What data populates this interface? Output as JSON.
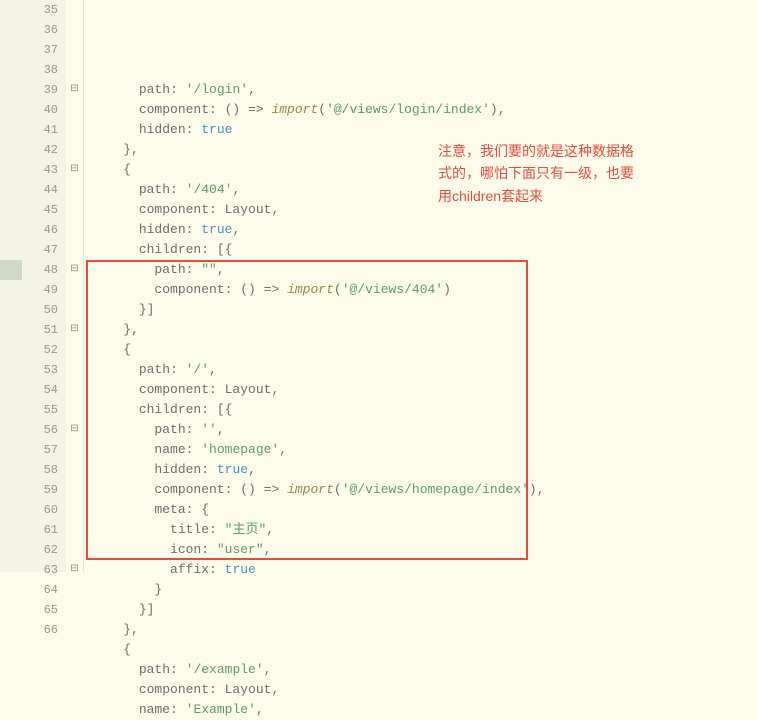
{
  "annotation": {
    "line1": "注意，我们要的就是这种数据格",
    "line2": "式的，哪怕下面只有一级，也要",
    "line3": "用children套起来"
  },
  "lines": [
    {
      "num": 35,
      "fold": false,
      "mark": false,
      "indent": 3,
      "tokens": [
        [
          "prop",
          "path"
        ],
        [
          "pun",
          ": "
        ],
        [
          "str",
          "'/login'"
        ],
        [
          "pun",
          ","
        ]
      ]
    },
    {
      "num": 36,
      "fold": false,
      "mark": false,
      "indent": 3,
      "tokens": [
        [
          "prop",
          "component"
        ],
        [
          "pun",
          ": () => "
        ],
        [
          "imp",
          "import"
        ],
        [
          "pun",
          "("
        ],
        [
          "str",
          "'@/views/login/index'"
        ],
        [
          "pun",
          "),"
        ]
      ]
    },
    {
      "num": 37,
      "fold": false,
      "mark": false,
      "indent": 3,
      "tokens": [
        [
          "prop",
          "hidden"
        ],
        [
          "pun",
          ": "
        ],
        [
          "bool",
          "true"
        ]
      ]
    },
    {
      "num": 38,
      "fold": false,
      "mark": false,
      "indent": 2,
      "tokens": [
        [
          "pun",
          "},"
        ]
      ]
    },
    {
      "num": 39,
      "fold": true,
      "mark": false,
      "indent": 2,
      "tokens": [
        [
          "pun",
          "{"
        ]
      ]
    },
    {
      "num": 40,
      "fold": false,
      "mark": false,
      "indent": 3,
      "tokens": [
        [
          "prop",
          "path"
        ],
        [
          "pun",
          ": "
        ],
        [
          "str",
          "'/404'"
        ],
        [
          "pun",
          ","
        ]
      ]
    },
    {
      "num": 41,
      "fold": false,
      "mark": false,
      "indent": 3,
      "tokens": [
        [
          "prop",
          "component"
        ],
        [
          "pun",
          ": Layout,"
        ]
      ]
    },
    {
      "num": 42,
      "fold": false,
      "mark": false,
      "indent": 3,
      "tokens": [
        [
          "prop",
          "hidden"
        ],
        [
          "pun",
          ": "
        ],
        [
          "bool",
          "true"
        ],
        [
          "pun",
          ","
        ]
      ]
    },
    {
      "num": 43,
      "fold": true,
      "mark": false,
      "indent": 3,
      "tokens": [
        [
          "prop",
          "children"
        ],
        [
          "pun",
          ": [{"
        ]
      ]
    },
    {
      "num": 44,
      "fold": false,
      "mark": false,
      "indent": 4,
      "tokens": [
        [
          "prop",
          "path"
        ],
        [
          "pun",
          ": "
        ],
        [
          "str",
          "\"\""
        ],
        [
          "pun",
          ","
        ]
      ]
    },
    {
      "num": 45,
      "fold": false,
      "mark": false,
      "indent": 4,
      "tokens": [
        [
          "prop",
          "component"
        ],
        [
          "pun",
          ": () => "
        ],
        [
          "imp",
          "import"
        ],
        [
          "pun",
          "("
        ],
        [
          "str",
          "'@/views/404'"
        ],
        [
          "pun",
          ")"
        ]
      ]
    },
    {
      "num": 46,
      "fold": false,
      "mark": false,
      "indent": 3,
      "tokens": [
        [
          "pun",
          "}]"
        ]
      ]
    },
    {
      "num": 47,
      "fold": false,
      "mark": false,
      "indent": 2,
      "tokens": [
        [
          "pun",
          "},"
        ]
      ]
    },
    {
      "num": 48,
      "fold": true,
      "mark": true,
      "indent": 2,
      "tokens": [
        [
          "pun",
          "{"
        ]
      ]
    },
    {
      "num": 49,
      "fold": false,
      "mark": false,
      "indent": 3,
      "tokens": [
        [
          "prop",
          "path"
        ],
        [
          "pun",
          ": "
        ],
        [
          "str",
          "'/'"
        ],
        [
          "pun",
          ","
        ]
      ]
    },
    {
      "num": 50,
      "fold": false,
      "mark": false,
      "indent": 3,
      "tokens": [
        [
          "prop",
          "component"
        ],
        [
          "pun",
          ": Layout,"
        ]
      ]
    },
    {
      "num": 51,
      "fold": true,
      "mark": false,
      "indent": 3,
      "tokens": [
        [
          "prop",
          "children"
        ],
        [
          "pun",
          ": [{"
        ]
      ]
    },
    {
      "num": 52,
      "fold": false,
      "mark": false,
      "indent": 4,
      "tokens": [
        [
          "prop",
          "path"
        ],
        [
          "pun",
          ": "
        ],
        [
          "str",
          "''"
        ],
        [
          "pun",
          ","
        ]
      ]
    },
    {
      "num": 53,
      "fold": false,
      "mark": false,
      "indent": 4,
      "tokens": [
        [
          "prop",
          "name"
        ],
        [
          "pun",
          ": "
        ],
        [
          "str",
          "'homepage'"
        ],
        [
          "pun",
          ","
        ]
      ]
    },
    {
      "num": 54,
      "fold": false,
      "mark": false,
      "indent": 4,
      "tokens": [
        [
          "prop",
          "hidden"
        ],
        [
          "pun",
          ": "
        ],
        [
          "bool",
          "true"
        ],
        [
          "pun",
          ","
        ]
      ]
    },
    {
      "num": 55,
      "fold": false,
      "mark": false,
      "indent": 4,
      "tokens": [
        [
          "prop",
          "component"
        ],
        [
          "pun",
          ": () => "
        ],
        [
          "imp",
          "import"
        ],
        [
          "pun",
          "("
        ],
        [
          "str",
          "'@/views/homepage/index'"
        ],
        [
          "pun",
          "),"
        ]
      ]
    },
    {
      "num": 56,
      "fold": true,
      "mark": false,
      "indent": 4,
      "tokens": [
        [
          "prop",
          "meta"
        ],
        [
          "pun",
          ": {"
        ]
      ]
    },
    {
      "num": 57,
      "fold": false,
      "mark": false,
      "indent": 5,
      "tokens": [
        [
          "prop",
          "title"
        ],
        [
          "pun",
          ": "
        ],
        [
          "str",
          "\"主页\""
        ],
        [
          "pun",
          ","
        ]
      ]
    },
    {
      "num": 58,
      "fold": false,
      "mark": false,
      "indent": 5,
      "tokens": [
        [
          "prop",
          "icon"
        ],
        [
          "pun",
          ": "
        ],
        [
          "str",
          "\"user\""
        ],
        [
          "pun",
          ","
        ]
      ]
    },
    {
      "num": 59,
      "fold": false,
      "mark": false,
      "indent": 5,
      "tokens": [
        [
          "prop",
          "affix"
        ],
        [
          "pun",
          ": "
        ],
        [
          "bool",
          "true"
        ]
      ]
    },
    {
      "num": 60,
      "fold": false,
      "mark": false,
      "indent": 4,
      "tokens": [
        [
          "pun",
          "}"
        ]
      ]
    },
    {
      "num": 61,
      "fold": false,
      "mark": false,
      "indent": 3,
      "tokens": [
        [
          "pun",
          "}]"
        ]
      ]
    },
    {
      "num": 62,
      "fold": false,
      "mark": false,
      "indent": 2,
      "tokens": [
        [
          "pun",
          "},"
        ]
      ]
    },
    {
      "num": 63,
      "fold": true,
      "mark": false,
      "indent": 2,
      "tokens": [
        [
          "pun",
          "{"
        ]
      ]
    },
    {
      "num": 64,
      "fold": false,
      "mark": false,
      "indent": 3,
      "tokens": [
        [
          "prop",
          "path"
        ],
        [
          "pun",
          ": "
        ],
        [
          "str",
          "'/example'"
        ],
        [
          "pun",
          ","
        ]
      ]
    },
    {
      "num": 65,
      "fold": false,
      "mark": false,
      "indent": 3,
      "tokens": [
        [
          "prop",
          "component"
        ],
        [
          "pun",
          ": Layout,"
        ]
      ]
    },
    {
      "num": 66,
      "fold": false,
      "mark": false,
      "indent": 3,
      "tokens": [
        [
          "prop",
          "name"
        ],
        [
          "pun",
          ": "
        ],
        [
          "str",
          "'Example'"
        ],
        [
          "pun",
          ","
        ]
      ]
    }
  ],
  "highlight_box": {
    "top_line": 48,
    "bottom_line": 62
  },
  "colors": {
    "bg": "#fdfceb",
    "gutter": "#f3f3e6",
    "annotation": "#e74c3c",
    "string": "#5a9e68",
    "bool": "#4a90c0",
    "import": "#9a8a4a"
  }
}
